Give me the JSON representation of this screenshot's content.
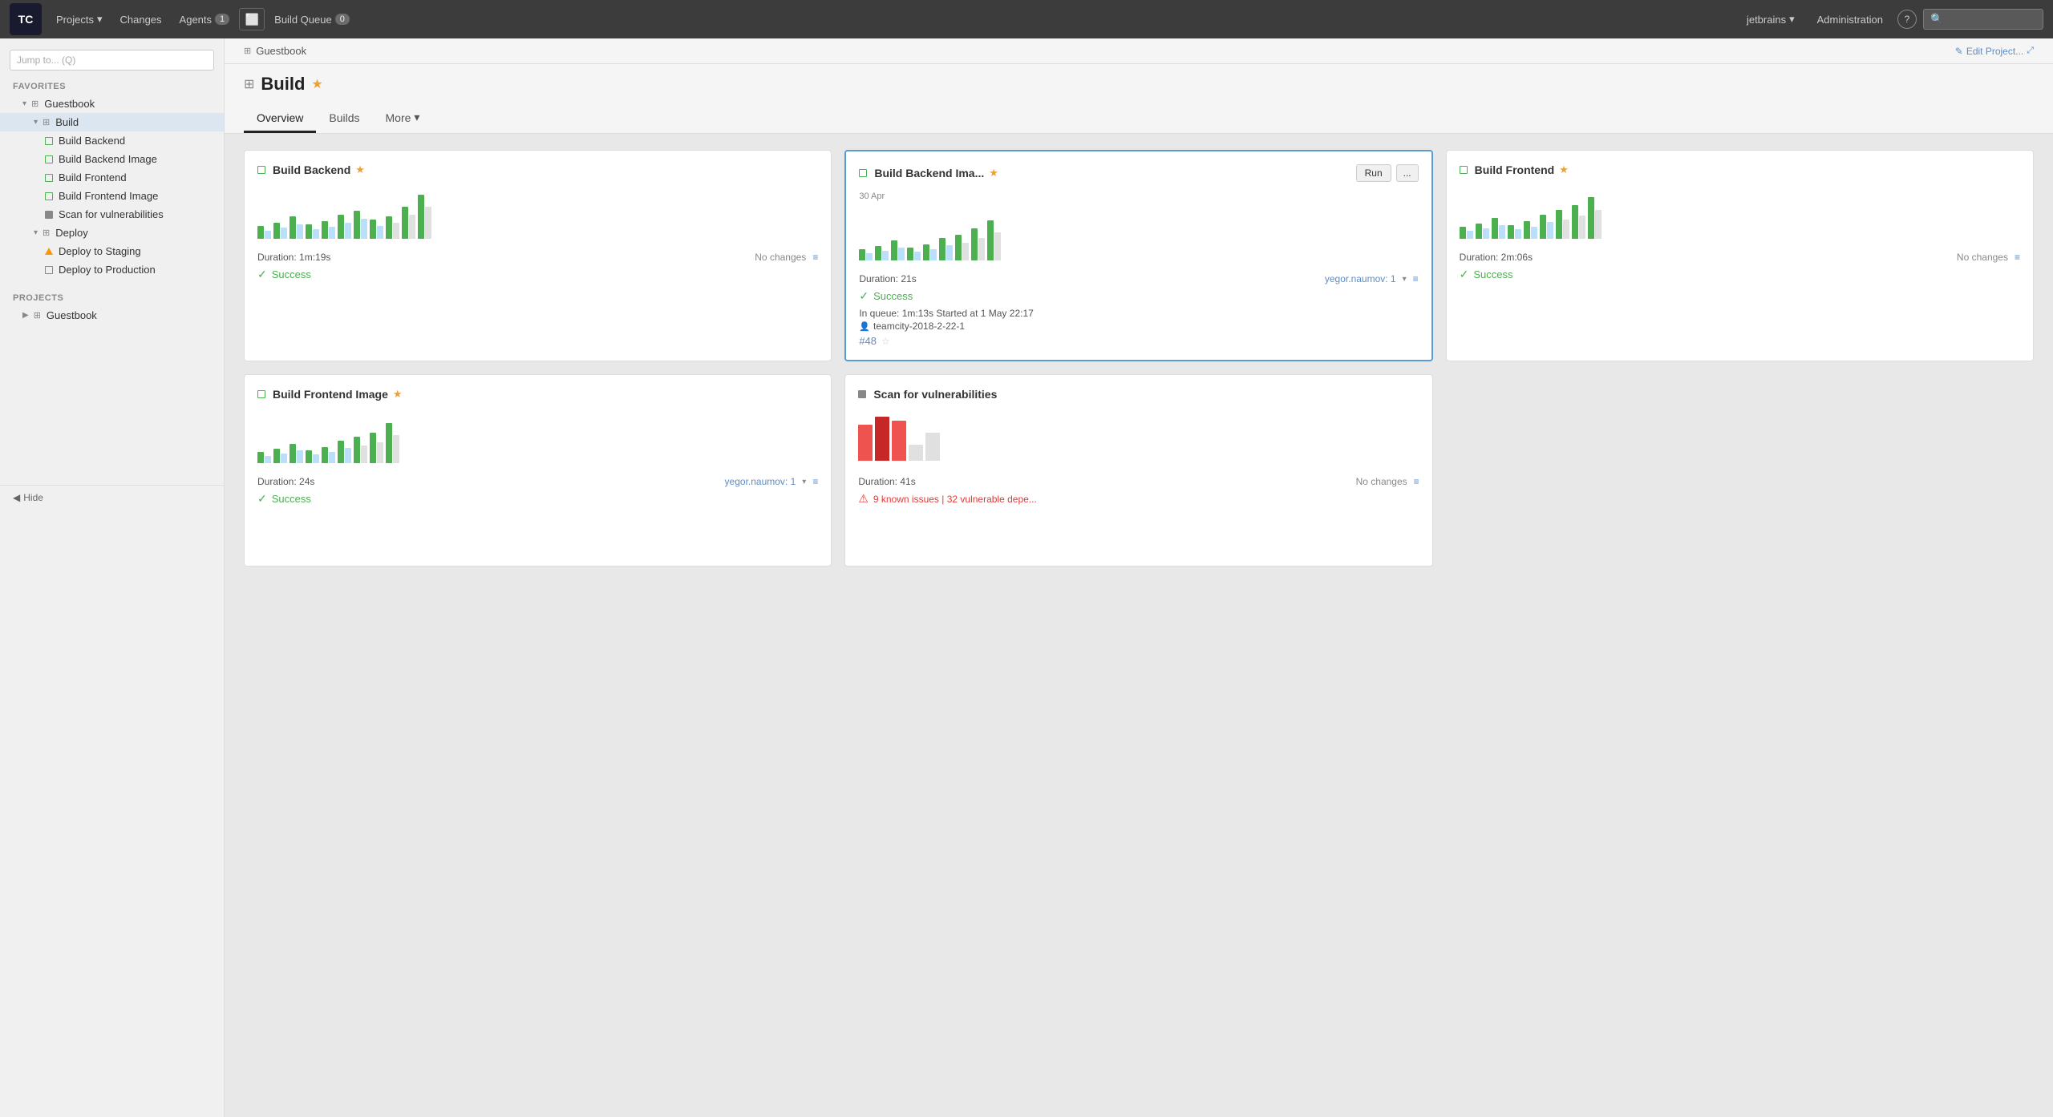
{
  "topnav": {
    "logo": "TC",
    "projects_label": "Projects",
    "changes_label": "Changes",
    "agents_label": "Agents",
    "agents_count": "1",
    "build_queue_label": "Build Queue",
    "build_queue_count": "0",
    "user_label": "jetbrains",
    "administration_label": "Administration",
    "search_placeholder": ""
  },
  "sidebar": {
    "jump_placeholder": "Jump to... (Q)",
    "favorites_title": "FAVORITES",
    "projects_title": "PROJECTS",
    "items": [
      {
        "label": "Guestbook",
        "level": 1,
        "icon": "grid",
        "expanded": true
      },
      {
        "label": "Build",
        "level": 2,
        "icon": "grid",
        "expanded": true,
        "active": true
      },
      {
        "label": "Build Backend",
        "level": 3,
        "icon": "square-green"
      },
      {
        "label": "Build Backend Image",
        "level": 3,
        "icon": "square-green"
      },
      {
        "label": "Build Frontend",
        "level": 3,
        "icon": "square-green"
      },
      {
        "label": "Build Frontend Image",
        "level": 3,
        "icon": "square-green"
      },
      {
        "label": "Scan for vulnerabilities",
        "level": 3,
        "icon": "filled-square"
      },
      {
        "label": "Deploy",
        "level": 2,
        "icon": "grid",
        "expanded": true
      },
      {
        "label": "Deploy to Staging",
        "level": 3,
        "icon": "triangle"
      },
      {
        "label": "Deploy to Production",
        "level": 3,
        "icon": "square-grey"
      }
    ],
    "projects_items": [
      {
        "label": "Guestbook",
        "level": 1,
        "icon": "grid"
      }
    ],
    "hide_label": "Hide"
  },
  "breadcrumb": {
    "project": "Guestbook"
  },
  "page": {
    "title": "Build",
    "edit_label": "Edit Project...",
    "tabs": [
      {
        "label": "Overview",
        "active": true
      },
      {
        "label": "Builds",
        "active": false
      },
      {
        "label": "More",
        "active": false
      }
    ]
  },
  "cards": [
    {
      "id": "build-backend",
      "title": "Build Backend",
      "starred": true,
      "duration": "Duration: 1m:19s",
      "changes": "No changes",
      "status": "Success",
      "status_type": "success",
      "bars": [
        2,
        3,
        5,
        3,
        4,
        5,
        6,
        4,
        5,
        7,
        5,
        6,
        8,
        6,
        7,
        9,
        7,
        5,
        8,
        6,
        10
      ]
    },
    {
      "id": "build-backend-image",
      "title": "Build Backend Ima...",
      "starred": true,
      "highlighted": true,
      "date": "30 Apr",
      "run_btn": "Run",
      "more_btn": "...",
      "duration": "Duration: 21s",
      "changes": "yegor.naumov: 1",
      "status": "Success",
      "status_type": "success",
      "queue_info": "In queue: 1m:13s   Started at 1 May 22:17",
      "agent": "teamcity-2018-2-22-1",
      "build_num": "#48",
      "bars": [
        2,
        3,
        5,
        3,
        4,
        5,
        6,
        4,
        5,
        7,
        5,
        6,
        8,
        6,
        7,
        9,
        7,
        5,
        8,
        10,
        9
      ]
    },
    {
      "id": "build-frontend",
      "title": "Build Frontend",
      "starred": true,
      "duration": "Duration: 2m:06s",
      "changes": "No changes",
      "status": "Success",
      "status_type": "success",
      "bars": [
        2,
        3,
        5,
        3,
        4,
        5,
        6,
        4,
        5,
        7,
        5,
        6,
        8,
        6,
        7,
        9,
        7,
        5,
        8,
        6,
        10
      ]
    },
    {
      "id": "build-frontend-image",
      "title": "Build Frontend Image",
      "starred": true,
      "duration": "Duration: 24s",
      "changes": "yegor.naumov: 1",
      "status": "Success",
      "status_type": "success",
      "bars": [
        2,
        3,
        5,
        3,
        4,
        5,
        6,
        4,
        5,
        7,
        5,
        6,
        8,
        6,
        7,
        9,
        7,
        5,
        8,
        6,
        10
      ]
    },
    {
      "id": "scan-vulnerabilities",
      "title": "Scan for vulnerabilities",
      "starred": false,
      "duration": "Duration: 41s",
      "changes": "No changes",
      "status": "9 known issues | 32 vulnerable depe...",
      "status_type": "error",
      "bars_red": true
    }
  ]
}
